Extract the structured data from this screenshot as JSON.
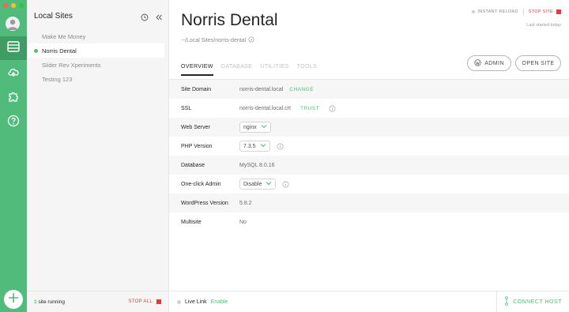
{
  "colors": {
    "accent": "#51bb7b",
    "danger": "#e33b3b"
  },
  "rail": {
    "items": [
      {
        "name": "sites-icon",
        "active": true
      },
      {
        "name": "cloud-icon",
        "active": false
      },
      {
        "name": "addons-puzzle-icon",
        "active": false
      },
      {
        "name": "help-icon",
        "active": false
      }
    ]
  },
  "sidebar": {
    "title": "Local Sites",
    "sites": [
      {
        "label": "Make Me Money",
        "running": false,
        "selected": false
      },
      {
        "label": "Norris Dental",
        "running": true,
        "selected": true
      },
      {
        "label": "Slider Rev Xperiments",
        "running": false,
        "selected": false
      },
      {
        "label": "Testing 123",
        "running": false,
        "selected": false
      }
    ],
    "footer": {
      "count": "1",
      "running_text": "site running",
      "stop_all": "STOP ALL"
    }
  },
  "site": {
    "title": "Norris Dental",
    "path": "~/Local Sites/norris-dental",
    "instant_reload": "INSTANT RELOAD",
    "stop_site": "STOP SITE",
    "last_started": "Last started today"
  },
  "tabs": [
    "OVERVIEW",
    "DATABASE",
    "UTILITIES",
    "TOOLS"
  ],
  "buttons": {
    "admin": "ADMIN",
    "open_site": "OPEN SITE"
  },
  "overview": {
    "site_domain": {
      "label": "Site Domain",
      "value": "norris-dental.local",
      "action": "CHANGE"
    },
    "ssl": {
      "label": "SSL",
      "value": "norris-dental.local.crt",
      "action": "TRUST"
    },
    "web_server": {
      "label": "Web Server",
      "value": "nginx"
    },
    "php_version": {
      "label": "PHP Version",
      "value": "7.3.5"
    },
    "database": {
      "label": "Database",
      "value": "MySQL 8.0.16"
    },
    "one_click_admin": {
      "label": "One-click Admin",
      "value": "Disable"
    },
    "wordpress_version": {
      "label": "WordPress Version",
      "value": "5.8.2"
    },
    "multisite": {
      "label": "Multisite",
      "value": "No"
    }
  },
  "footer": {
    "live_link": "Live Link",
    "enable": "Enable",
    "connect_host": "CONNECT HOST"
  }
}
